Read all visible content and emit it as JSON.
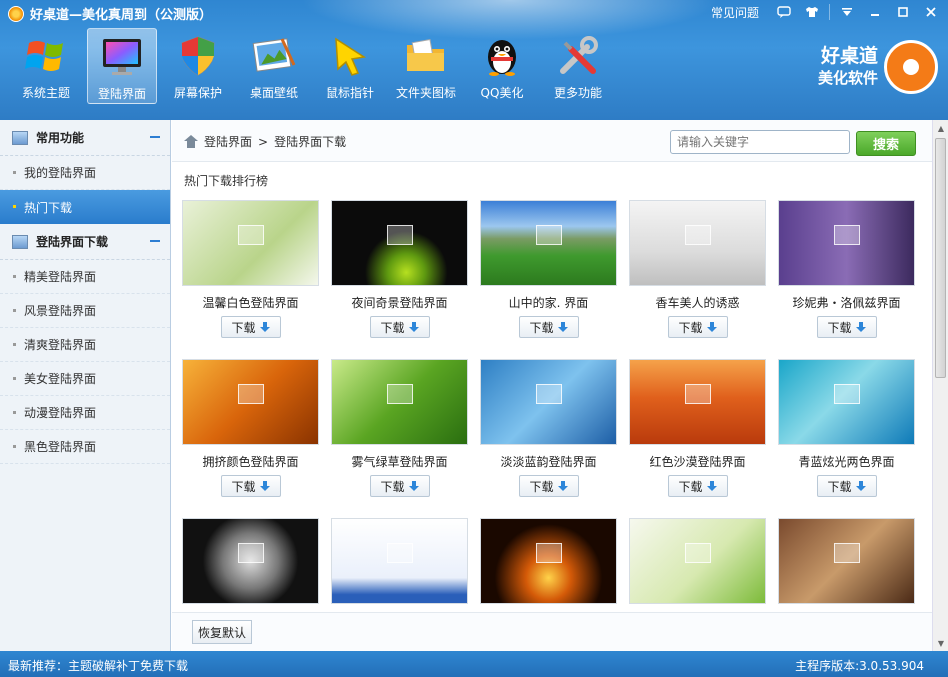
{
  "app": {
    "title": "好桌道—美化真周到（公测版）",
    "faq": "常见问题",
    "brand_line1": "好桌道",
    "brand_line2": "美化软件"
  },
  "toolbar": [
    {
      "label": "系统主题",
      "icon": "windows-logo-icon"
    },
    {
      "label": "登陆界面",
      "icon": "monitor-icon",
      "active": true
    },
    {
      "label": "屏幕保护",
      "icon": "shield-icon"
    },
    {
      "label": "桌面壁纸",
      "icon": "wallpaper-icon"
    },
    {
      "label": "鼠标指针",
      "icon": "cursor-icon"
    },
    {
      "label": "文件夹图标",
      "icon": "folder-icon"
    },
    {
      "label": "QQ美化",
      "icon": "qq-penguin-icon"
    },
    {
      "label": "更多功能",
      "icon": "tools-icon"
    }
  ],
  "sidebar": {
    "section1": "常用功能",
    "section1_items": [
      {
        "label": "我的登陆界面"
      },
      {
        "label": "热门下载",
        "active": true
      }
    ],
    "section2": "登陆界面下载",
    "section2_items": [
      {
        "label": "精美登陆界面"
      },
      {
        "label": "风景登陆界面"
      },
      {
        "label": "清爽登陆界面"
      },
      {
        "label": "美女登陆界面"
      },
      {
        "label": "动漫登陆界面"
      },
      {
        "label": "黑色登陆界面"
      }
    ]
  },
  "breadcrumb": {
    "root": "登陆界面",
    "separator": ">",
    "current": "登陆界面下载"
  },
  "search": {
    "placeholder": "请输入关键字",
    "button": "搜索"
  },
  "rank_title": "热门下载排行榜",
  "download_label": "下载",
  "items": [
    {
      "label": "温馨白色登陆界面",
      "bg": "linear-gradient(135deg,#e9f1d8,#b9d48a 60%,#f4f7ec)"
    },
    {
      "label": "夜间奇景登陆界面",
      "bg": "radial-gradient(circle at 55% 85%,#b6e020 0%,#5f9a10 18%,#0b0b0b 40%)"
    },
    {
      "label": "山中的家. 界面",
      "bg": "linear-gradient(180deg,#3b7fd6 0%,#9cc7ef 30%,#7a9b64 45%,#3f9a2e 65%,#2c7a1e 100%)"
    },
    {
      "label": "香车美人的诱惑",
      "bg": "linear-gradient(180deg,#f4f4f4,#dcdcdc 60%,#bfbfbf)"
    },
    {
      "label": "珍妮弗・洛佩兹界面",
      "bg": "linear-gradient(90deg,#5a3f8e,#8a6cb5 50%,#3c2a5e)"
    },
    {
      "label": "拥挤颜色登陆界面",
      "bg": "linear-gradient(135deg,#f7b23a,#d9650b 50%,#8a3300)"
    },
    {
      "label": "雾气绿草登陆界面",
      "bg": "linear-gradient(135deg,#c9ea8a,#5aa522 50%,#2a6e10)"
    },
    {
      "label": "淡淡蓝韵登陆界面",
      "bg": "linear-gradient(135deg,#2e7fc4,#7ec2ee 50%,#1d5ea6)"
    },
    {
      "label": "红色沙漠登陆界面",
      "bg": "linear-gradient(180deg,#f5a24a,#e0601c 45%,#b93a0c)"
    },
    {
      "label": "青蓝炫光两色界面",
      "bg": "linear-gradient(135deg,#1aa6c9,#8ad9e8 45%,#0e7ab8)"
    },
    {
      "label": "",
      "bg": "radial-gradient(circle at 50% 50%,#ddd 0%,#777 35%,#111 60%)"
    },
    {
      "label": "",
      "bg": "linear-gradient(180deg,#ffffff,#eaf0fb 70%,#2a5fb9 90%)"
    },
    {
      "label": "",
      "bg": "radial-gradient(circle at 50% 70%,#ffd34a 0%,#d45a08 25%,#1a0800 60%)"
    },
    {
      "label": "",
      "bg": "linear-gradient(135deg,#f6f8ee,#d7e9b0 55%,#7dbb3a)"
    },
    {
      "label": "",
      "bg": "linear-gradient(135deg,#7a4a2e,#c89a6a 50%,#4b2a16)"
    }
  ],
  "restore_button": "恢复默认",
  "footer": {
    "recommend": "最新推荐：主题破解补丁免费下载",
    "version": "主程序版本:3.0.53.904"
  }
}
